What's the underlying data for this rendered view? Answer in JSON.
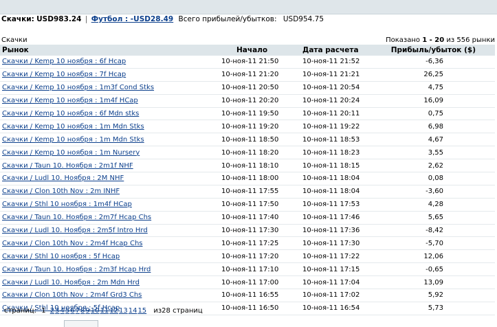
{
  "summary": {
    "racing_label": "Скачки:",
    "racing_value": "USD983.24",
    "separator": "|",
    "football_link": "Футбол : -USD28.49",
    "total_label": "Всего прибылей/убытков:",
    "total_value": "USD954.75"
  },
  "section": {
    "sport_label": "Скачки",
    "shown_prefix": "Показано",
    "shown_range": "1 - 20",
    "shown_suffix": "из 556 рынки"
  },
  "table": {
    "headers": {
      "market": "Рынок",
      "start": "Начало",
      "settled": "Дата расчета",
      "pl": "Прибыль/убыток ($)"
    },
    "rows": [
      {
        "market": "Скачки / Kemp 10 ноября : 6f Hcap",
        "start": "10-ноя-11 21:50",
        "settled": "10-ноя-11 21:52",
        "pl": "-6,36"
      },
      {
        "market": "Скачки / Kemp 10 ноября : 7f Hcap",
        "start": "10-ноя-11 21:20",
        "settled": "10-ноя-11 21:21",
        "pl": "26,25"
      },
      {
        "market": "Скачки / Kemp 10 ноября : 1m3f Cond Stks",
        "start": "10-ноя-11 20:50",
        "settled": "10-ноя-11 20:54",
        "pl": "4,75"
      },
      {
        "market": "Скачки / Kemp 10 ноября : 1m4f HCap",
        "start": "10-ноя-11 20:20",
        "settled": "10-ноя-11 20:24",
        "pl": "16,09"
      },
      {
        "market": "Скачки / Kemp 10 ноября : 6f Mdn stks",
        "start": "10-ноя-11 19:50",
        "settled": "10-ноя-11 20:11",
        "pl": "0,75"
      },
      {
        "market": "Скачки / Kemp 10 ноября : 1m Mdn Stks",
        "start": "10-ноя-11 19:20",
        "settled": "10-ноя-11 19:22",
        "pl": "6,98"
      },
      {
        "market": "Скачки / Kemp 10 ноября : 1m Mdn Stks",
        "start": "10-ноя-11 18:50",
        "settled": "10-ноя-11 18:53",
        "pl": "4,67"
      },
      {
        "market": "Скачки / Kemp 10 ноября : 1m Nursery",
        "start": "10-ноя-11 18:20",
        "settled": "10-ноя-11 18:23",
        "pl": "3,55"
      },
      {
        "market": "Скачки / Taun 10. Ноября : 2m1f NHF",
        "start": "10-ноя-11 18:10",
        "settled": "10-ноя-11 18:15",
        "pl": "2,62"
      },
      {
        "market": "Скачки / Ludl 10. Ноября : 2M NHF",
        "start": "10-ноя-11 18:00",
        "settled": "10-ноя-11 18:04",
        "pl": "0,08"
      },
      {
        "market": "Скачки / Clon 10th Nov : 2m INHF",
        "start": "10-ноя-11 17:55",
        "settled": "10-ноя-11 18:04",
        "pl": "-3,60"
      },
      {
        "market": "Скачки / Sthl 10 ноября : 1m4f HCap",
        "start": "10-ноя-11 17:50",
        "settled": "10-ноя-11 17:53",
        "pl": "4,28"
      },
      {
        "market": "Скачки / Taun 10. Ноября : 2m7f Hcap Chs",
        "start": "10-ноя-11 17:40",
        "settled": "10-ноя-11 17:46",
        "pl": "5,65"
      },
      {
        "market": "Скачки / Ludl 10. Ноября : 2m5f Intro Hrd",
        "start": "10-ноя-11 17:30",
        "settled": "10-ноя-11 17:36",
        "pl": "-8,42"
      },
      {
        "market": "Скачки / Clon 10th Nov : 2m4f Hcap Chs",
        "start": "10-ноя-11 17:25",
        "settled": "10-ноя-11 17:30",
        "pl": "-5,70"
      },
      {
        "market": "Скачки / Sthl 10 ноября : 5f Hcap",
        "start": "10-ноя-11 17:20",
        "settled": "10-ноя-11 17:22",
        "pl": "12,06"
      },
      {
        "market": "Скачки / Taun 10. Ноября : 2m3f Hcap Hrd",
        "start": "10-ноя-11 17:10",
        "settled": "10-ноя-11 17:15",
        "pl": "-0,65"
      },
      {
        "market": "Скачки / Ludl 10. Ноября : 2m Mdn Hrd",
        "start": "10-ноя-11 17:00",
        "settled": "10-ноя-11 17:04",
        "pl": "13,09"
      },
      {
        "market": "Скачки / Clon 10th Nov : 2m4f Grd3 Chs",
        "start": "10-ноя-11 16:55",
        "settled": "10-ноя-11 17:02",
        "pl": "5,92"
      },
      {
        "market": "Скачки / Sthl 10 ноября : 5f Hcap",
        "start": "10-ноя-11 16:50",
        "settled": "10-ноя-11 16:54",
        "pl": "5,73"
      }
    ]
  },
  "pager": {
    "label": "страниц:",
    "current": "1",
    "pages": [
      "2",
      "3",
      "4",
      "5",
      "6",
      "7",
      "8",
      "9",
      "10",
      "11",
      "12",
      "13",
      "14",
      "15"
    ],
    "total": "из28 страниц"
  },
  "colors": {
    "link": "#0b3f8c",
    "header_bg": "#dde5e9",
    "top_band": "#dfe6ea"
  }
}
